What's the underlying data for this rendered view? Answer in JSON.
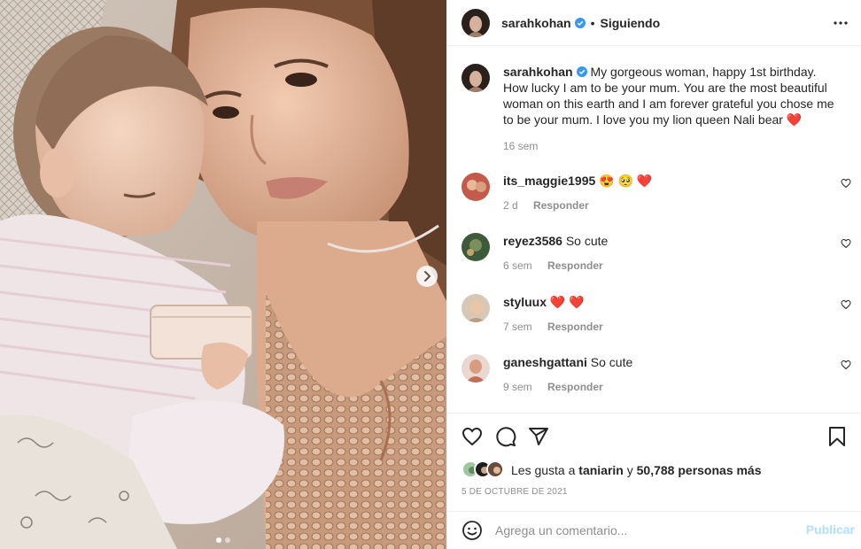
{
  "post": {
    "username": "sarahkohan",
    "follow_status": "Siguiendo",
    "separator": "•",
    "caption": "My gorgeous woman, happy 1st birthday. How lucky I am to be your mum. You are the most beautiful woman on this earth and I am forever grateful you chose me to be your mum. I love you my lion queen Nali bear",
    "caption_emoji": "❤️",
    "caption_time": "16 sem"
  },
  "comments": [
    {
      "username": "its_maggie1995",
      "text": "😍 🥺 ❤️",
      "time": "2 d",
      "reply_label": "Responder"
    },
    {
      "username": "reyez3586",
      "text": "So cute",
      "time": "6 sem",
      "reply_label": "Responder"
    },
    {
      "username": "styluux",
      "text": "❤️ ❤️",
      "time": "7 sem",
      "reply_label": "Responder"
    },
    {
      "username": "ganeshgattani",
      "text": "So cute",
      "time": "9 sem",
      "reply_label": "Responder"
    }
  ],
  "likes": {
    "prefix": "Les gusta a",
    "first_user": "taniarin",
    "connector": "y",
    "count_text": "50,788 personas más"
  },
  "date": "5 DE OCTUBRE DE 2021",
  "comment_box": {
    "placeholder": "Agrega un comentario...",
    "publish_label": "Publicar"
  },
  "colors": {
    "verified": "#3897f0",
    "heart": "#ed4956",
    "publish_disabled": "#b2dffc",
    "muted": "#8e8e8e"
  },
  "icons": [
    "chevron-right-icon",
    "more-options-icon",
    "verified-badge-icon",
    "heart-icon",
    "comment-icon",
    "share-icon",
    "bookmark-icon",
    "emoji-icon"
  ],
  "carousel": {
    "slides": 2,
    "active": 1
  }
}
